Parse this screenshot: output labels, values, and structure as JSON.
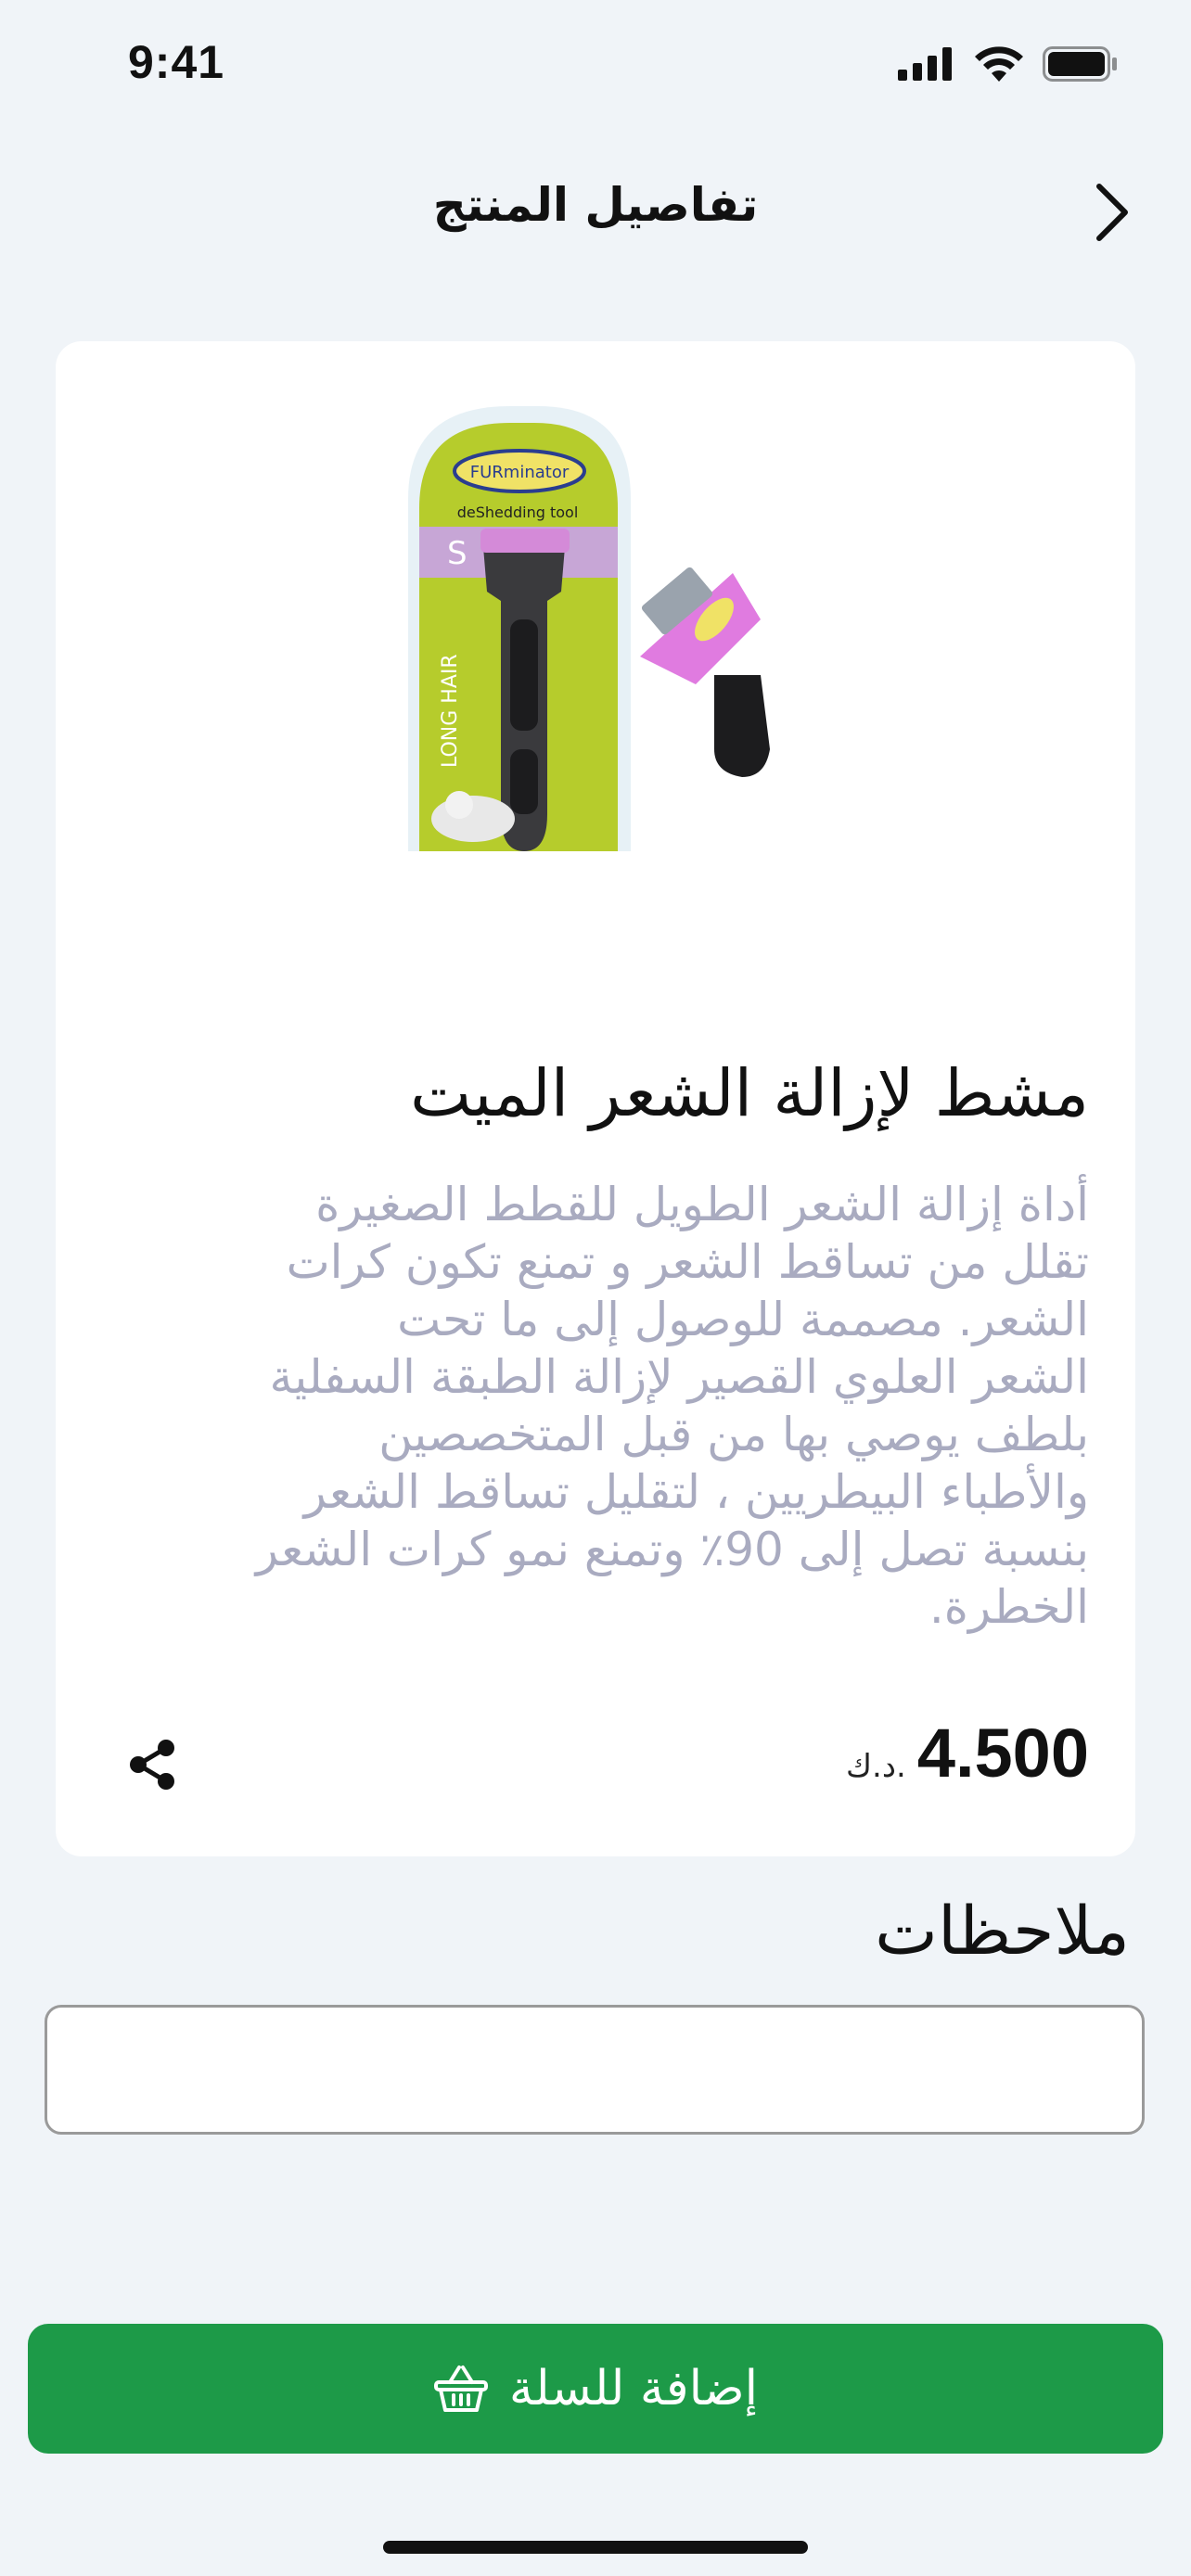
{
  "status_bar": {
    "time": "9:41",
    "icons": [
      "cellular-signal-icon",
      "wifi-icon",
      "battery-icon"
    ]
  },
  "header": {
    "title": "تفاصيل المنتج",
    "back_icon": "chevron-right-icon"
  },
  "product": {
    "image_alt": "FURminator deShedding tool - Long Hair - S",
    "name": "مشط لإزالة الشعر الميت",
    "description_lines": [
      "أداة إزالة الشعر الطويل للقطط الصغيرة",
      "تقلل من تساقط الشعر و تمنع تكون كرات",
      "الشعر. مصممة للوصول إلى ما تحت",
      "الشعر العلوي القصير لإزالة الطبقة السفلية",
      "بلطف يوصي بها من قبل المتخصصين",
      "والأطباء البيطريين ، لتقليل تساقط الشعر",
      "بنسبة تصل إلى 90٪ وتمنع نمو كرات الشعر",
      "الخطرة."
    ],
    "price_value": "4.500",
    "price_currency": "د.ك.",
    "share_icon": "share-icon"
  },
  "notes": {
    "label": "ملاحظات",
    "value": "",
    "placeholder": ""
  },
  "cart_button": {
    "label": "إضافة للسلة",
    "icon": "basket-icon"
  },
  "colors": {
    "background": "#f0f4f8",
    "accent": "#1d9a48",
    "description_text": "#a9abc0"
  }
}
